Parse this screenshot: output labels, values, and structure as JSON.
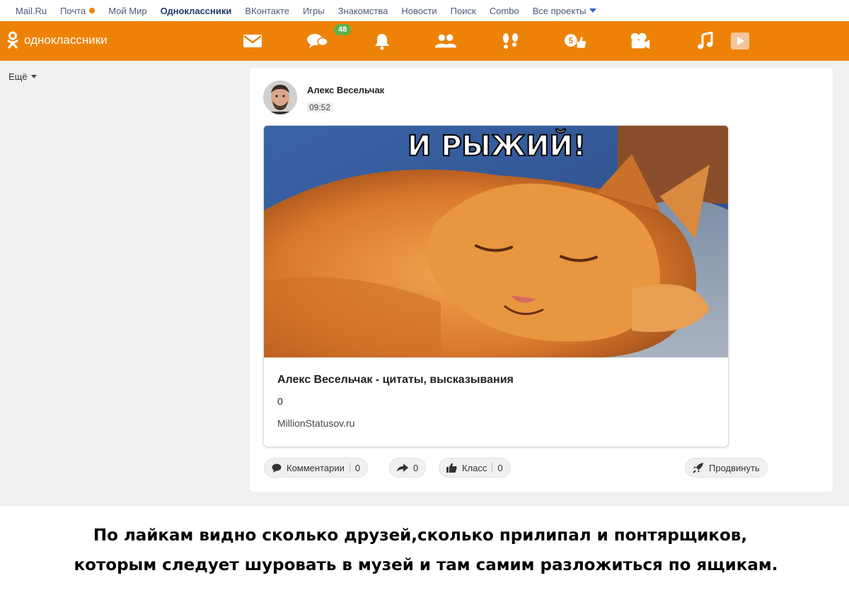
{
  "portal": {
    "links": [
      "Mail.Ru",
      "Почта",
      "Мой Мир",
      "Одноклассники",
      "ВКонтакте",
      "Игры",
      "Знакомства",
      "Новости",
      "Поиск",
      "Combo",
      "Все проекты"
    ]
  },
  "header": {
    "logo_text": "одноклассники",
    "messages_badge": "48",
    "icons": [
      "mail-icon",
      "chat-icon",
      "bell-icon",
      "friends-icon",
      "guests-icon",
      "events-icon",
      "video-icon",
      "music-icon",
      "play-icon"
    ],
    "accent": "#ee8208"
  },
  "sidebar": {
    "more_label": "Ещё"
  },
  "post": {
    "author": "Алекс Весельчак",
    "time": "09:52",
    "image_caption": "И РЫЖИЙ!",
    "link_title": "Алекс Весельчак - цитаты, высказывания",
    "link_count": "0",
    "link_domain": "MillionStatusov.ru",
    "actions": {
      "comments_label": "Комментарии",
      "comments_count": "0",
      "share_count": "0",
      "like_label": "Класс",
      "like_count": "0",
      "promote_label": "Продвинуть"
    }
  },
  "caption": {
    "line1": "По лайкам видно сколько друзей,сколько прилипал и понтярщиков,",
    "line2": "которым следует шуровать в музей  и там самим разложиться по ящикам."
  }
}
